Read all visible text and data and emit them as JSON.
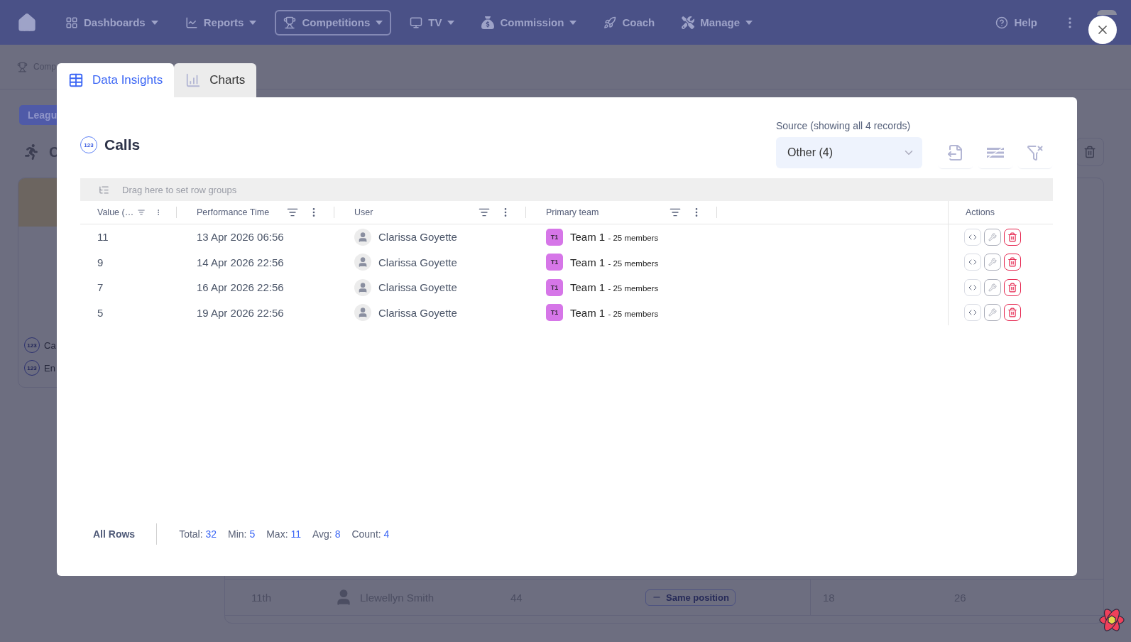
{
  "nav": {
    "items": [
      {
        "label": "Dashboards",
        "dropdown": true,
        "selected": false
      },
      {
        "label": "Reports",
        "dropdown": true,
        "selected": false
      },
      {
        "label": "Competitions",
        "dropdown": true,
        "selected": true
      },
      {
        "label": "TV",
        "dropdown": true,
        "selected": false
      },
      {
        "label": "Commission",
        "dropdown": true,
        "selected": false
      },
      {
        "label": "Coach",
        "dropdown": false,
        "selected": false
      },
      {
        "label": "Manage",
        "dropdown": true,
        "selected": false
      }
    ],
    "help": "Help"
  },
  "breadcrumb": "Comp",
  "background": {
    "league_button": "Leagu",
    "section_title": "C",
    "metrics": [
      {
        "badge": "123",
        "label": "Ca"
      },
      {
        "badge": "123",
        "label": "En"
      }
    ],
    "row": {
      "rank": "11th",
      "name": "Llewellyn Smith",
      "score": "44",
      "movement": "Same position",
      "column_5": "18",
      "column_6": "26"
    }
  },
  "dialog": {
    "tabs": [
      {
        "label": "Data Insights",
        "selected": true
      },
      {
        "label": "Charts",
        "selected": false
      }
    ],
    "title_badge": "123",
    "title": "Calls",
    "source_label": "Source (showing all 4 records)",
    "source_value": "Other (4)",
    "group_placeholder": "Drag here to set row groups",
    "columns": [
      {
        "label": "Value (…",
        "filter": true,
        "menu": true
      },
      {
        "label": "Performance Time",
        "filter": true,
        "menu": true
      },
      {
        "label": "User",
        "filter": true,
        "menu": true
      },
      {
        "label": "Primary team",
        "filter": true,
        "menu": true
      },
      {
        "label": "Actions",
        "filter": false,
        "menu": false
      }
    ],
    "rows": [
      {
        "value": "11",
        "time": "13 Apr 2026 06:56",
        "user": "Clarissa Goyette",
        "team_badge": "T1",
        "team": "Team 1",
        "team_members": "- 25 members"
      },
      {
        "value": "9",
        "time": "14 Apr 2026 22:56",
        "user": "Clarissa Goyette",
        "team_badge": "T1",
        "team": "Team 1",
        "team_members": "- 25 members"
      },
      {
        "value": "7",
        "time": "16 Apr 2026 22:56",
        "user": "Clarissa Goyette",
        "team_badge": "T1",
        "team": "Team 1",
        "team_members": "- 25 members"
      },
      {
        "value": "5",
        "time": "19 Apr 2026 22:56",
        "user": "Clarissa Goyette",
        "team_badge": "T1",
        "team": "Team 1",
        "team_members": "- 25 members"
      }
    ],
    "footer": {
      "label": "All Rows",
      "stats": [
        {
          "label": "Total:",
          "value": "32"
        },
        {
          "label": "Min:",
          "value": "5"
        },
        {
          "label": "Max:",
          "value": "11"
        },
        {
          "label": "Avg:",
          "value": "8"
        },
        {
          "label": "Count:",
          "value": "4"
        }
      ]
    }
  }
}
